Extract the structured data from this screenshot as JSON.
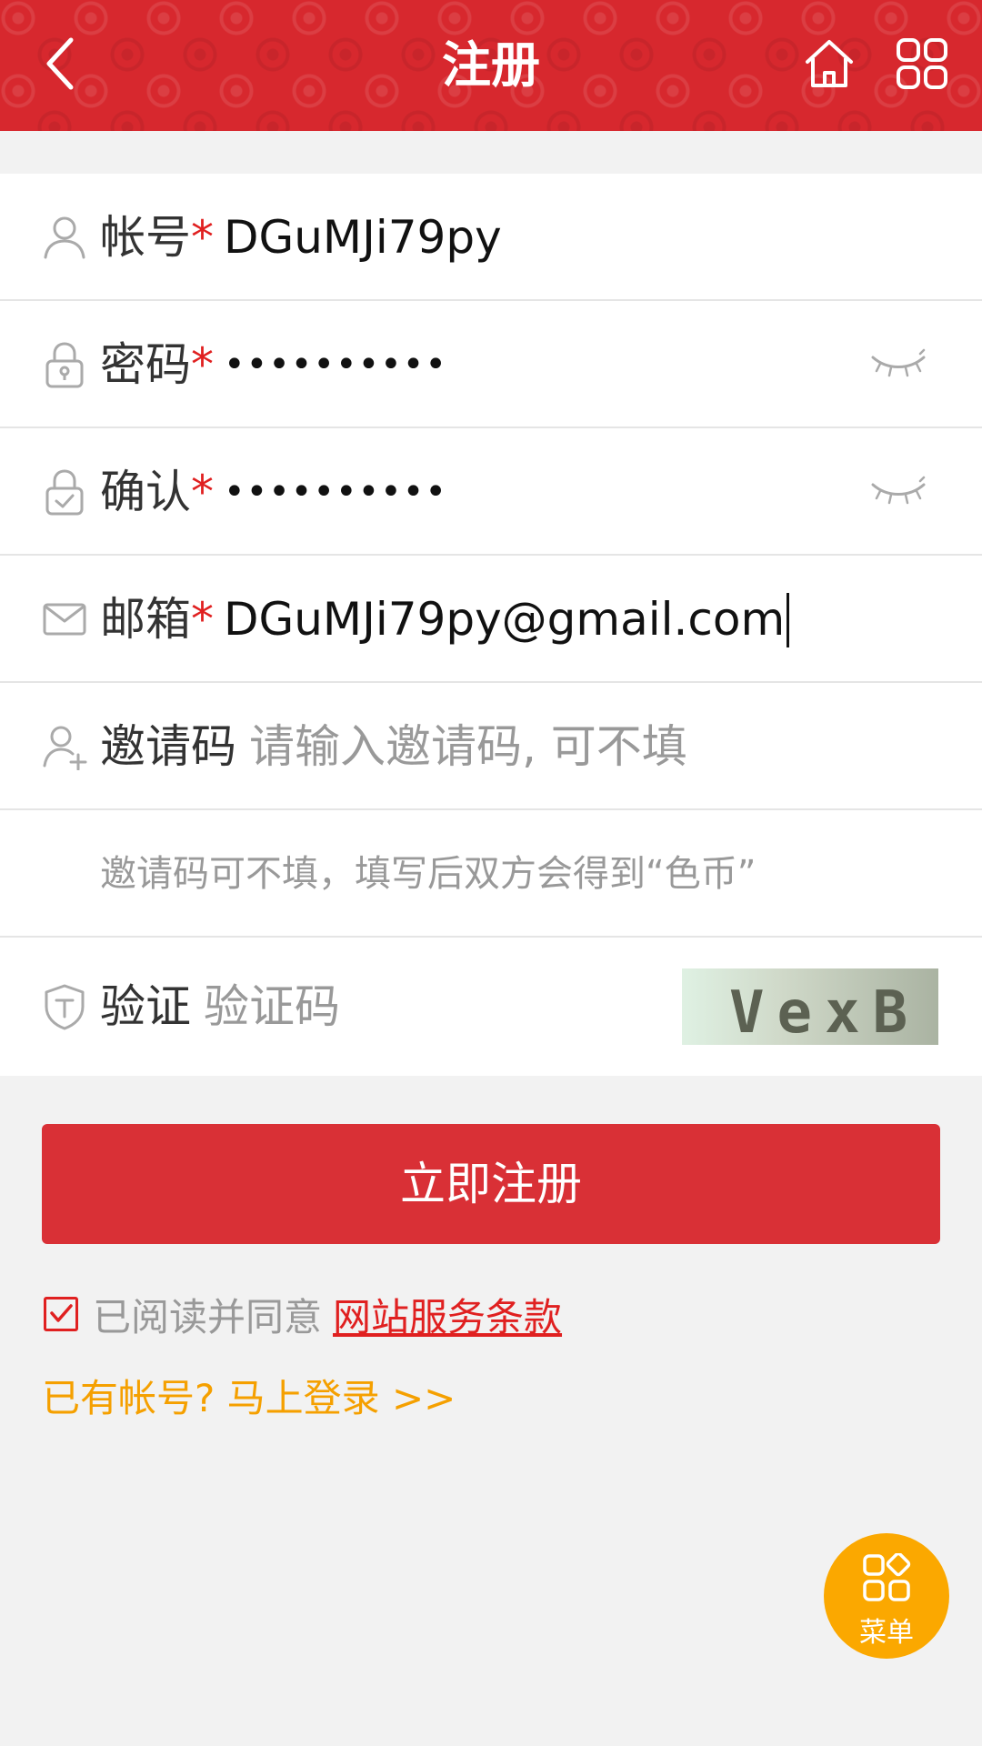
{
  "header": {
    "title": "注册"
  },
  "form": {
    "account": {
      "label": "帐号",
      "required": "*",
      "value": "DGuMJi79py"
    },
    "password": {
      "label": "密码",
      "required": "*",
      "value": "••••••••••"
    },
    "confirm": {
      "label": "确认",
      "required": "*",
      "value": "••••••••••"
    },
    "email": {
      "label": "邮箱",
      "required": "*",
      "value": "DGuMJi79py@gmail.com"
    },
    "invite": {
      "label": "邀请码",
      "placeholder": "请输入邀请码, 可不填"
    },
    "invite_hint": "邀请码可不填，填写后双方会得到“色币”",
    "verify": {
      "label": "验证",
      "placeholder": "验证码",
      "captcha_text": "VexB"
    }
  },
  "submit_label": "立即注册",
  "agreement": {
    "checked": true,
    "text": "已阅读并同意",
    "link": "网站服务条款"
  },
  "login_link": "已有帐号? 马上登录 >>",
  "fab": {
    "label": "菜单"
  },
  "colors": {
    "brand_red": "#d7282e",
    "button_red": "#d93036",
    "link_orange": "#f5a000",
    "fab_orange": "#fba800"
  }
}
